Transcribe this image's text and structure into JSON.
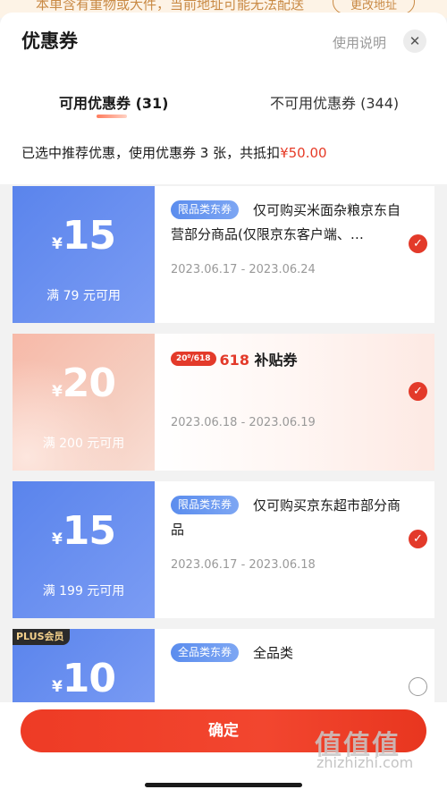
{
  "background_page": {
    "banner_text": "本单含有重物或大件，当前地址可能无法配送",
    "banner_button": "更改地址"
  },
  "header": {
    "title": "优惠券",
    "help_label": "使用说明",
    "close_symbol": "✕"
  },
  "tabs": [
    {
      "label": "可用优惠券 (31)",
      "active": true
    },
    {
      "label": "不可用优惠券 (344)",
      "active": false
    }
  ],
  "summary": {
    "text": "已选中推荐优惠，使用优惠券 3 张，共抵扣",
    "amount": "¥50.00"
  },
  "coupons": [
    {
      "currency": "¥",
      "amount": "15",
      "threshold": "满 79 元可用",
      "tag": "限品类东券",
      "description": "仅可购买米面杂粮京东自营部分商品(仅限京东客户端、…",
      "date_range": "2023.06.17 - 2023.06.24",
      "selected": true
    },
    {
      "currency": "¥",
      "amount": "20",
      "threshold": "满 200 元可用",
      "brand_logo_text": "20⁰/618",
      "brand_red": "618",
      "brand_label": "补贴券",
      "date_range": "2023.06.18 - 2023.06.19",
      "selected": true
    },
    {
      "currency": "¥",
      "amount": "15",
      "threshold": "满 199 元可用",
      "tag": "限品类东券",
      "description": "仅可购买京东超市部分商品",
      "date_range": "2023.06.17 - 2023.06.18",
      "selected": true
    },
    {
      "badge": "PLUS会员",
      "currency": "¥",
      "amount": "10",
      "tag": "全品类东券",
      "description": "全品类",
      "selected": false
    }
  ],
  "footer": {
    "confirm_label": "确定"
  },
  "watermark": {
    "logo_text": "值值值",
    "url": "zhizhizhi.com"
  },
  "icons": {
    "check": "check-icon",
    "close": "close-icon"
  },
  "colors": {
    "accent_red": "#e33a2a",
    "coupon_blue": "#5a84ec",
    "coupon_pink": "#f7b9a8"
  }
}
